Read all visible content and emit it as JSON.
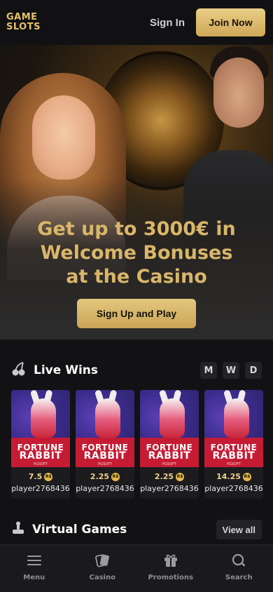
{
  "header": {
    "logo_line1": "GAME",
    "logo_line2": "SLOTS",
    "signin_label": "Sign In",
    "join_label": "Join Now"
  },
  "hero": {
    "title": "Get up to 3000€ in Welcome Bonuses at the Casino",
    "cta_label": "Sign Up and Play"
  },
  "live_wins": {
    "title": "Live Wins",
    "periods": [
      "M",
      "W",
      "D"
    ],
    "game_title_line1": "FORTUNE",
    "game_title_line2": "RABBIT",
    "game_provider": "PGSOFT",
    "currency_symbol": "R$",
    "items": [
      {
        "amount": "7.5",
        "player": "player2768436"
      },
      {
        "amount": "2.25",
        "player": "player2768436"
      },
      {
        "amount": "2.25",
        "player": "player2768436"
      },
      {
        "amount": "14.25",
        "player": "player2768436"
      }
    ]
  },
  "virtual_games": {
    "title": "Virtual Games",
    "view_all_label": "View all"
  },
  "bottom_nav": {
    "items": [
      {
        "label": "Menu",
        "icon": "menu-icon"
      },
      {
        "label": "Casino",
        "icon": "cards-icon"
      },
      {
        "label": "Promotions",
        "icon": "gift-icon"
      },
      {
        "label": "Search",
        "icon": "search-icon"
      }
    ]
  },
  "colors": {
    "gold": "#d8b66a",
    "background": "#121214",
    "card": "#1c1c1f",
    "button_gold": "#cfa657"
  }
}
